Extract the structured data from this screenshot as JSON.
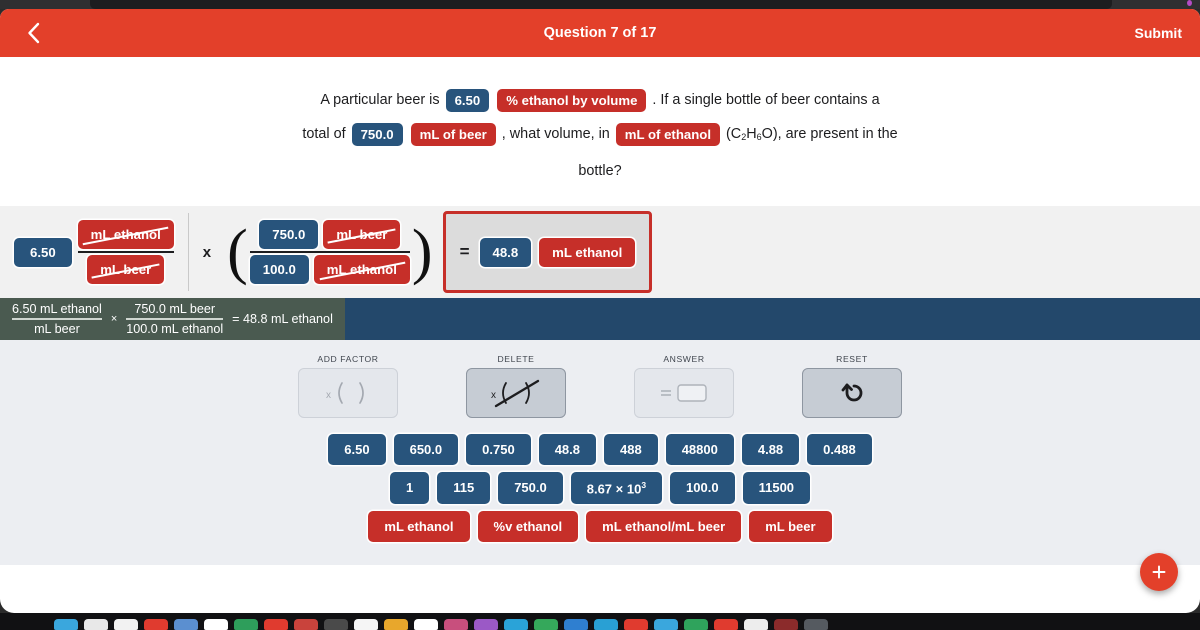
{
  "header": {
    "title": "Question 7 of 17",
    "back_icon": "chevron-left-icon",
    "submit_label": "Submit",
    "color": "#e3402a"
  },
  "question": {
    "part1": "A particular beer is",
    "value1": "6.50",
    "unit1": "% ethanol by volume",
    "part2": ". If a single bottle of beer contains a",
    "part3": "total of",
    "value2": "750.0",
    "unit2": "mL of beer",
    "part4": ", what volume, in",
    "unit3": "mL of ethanol",
    "formula_open": "(C",
    "formula_sub1": "2",
    "formula_h": "H",
    "formula_sub2": "6",
    "formula_close": "O),",
    "part5": "are present in the",
    "part6": "bottle?"
  },
  "equation": {
    "factor1": {
      "coefficient": "6.50",
      "numerator_unit": "mL ethanol",
      "denominator_unit": "mL beer"
    },
    "operator": "x",
    "factor2": {
      "paren_open": "(",
      "paren_close": ")",
      "numerator_value": "750.0",
      "numerator_unit": "mL beer",
      "denominator_value": "100.0",
      "denominator_unit": "mL ethanol"
    },
    "answer": {
      "equals": "=",
      "value": "48.8",
      "unit": "mL ethanol"
    }
  },
  "summary": {
    "num1": "6.50 mL ethanol",
    "den1": "mL beer",
    "times": "×",
    "num2": "750.0 mL beer",
    "den2": "100.0 mL ethanol",
    "result": "= 48.8 mL ethanol"
  },
  "tools": [
    {
      "label": "ADD FACTOR",
      "icon": "add-factor-icon",
      "state": "normal"
    },
    {
      "label": "DELETE",
      "icon": "delete-strike-icon",
      "state": "active"
    },
    {
      "label": "ANSWER",
      "icon": "answer-box-icon",
      "state": "disabled"
    },
    {
      "label": "RESET",
      "icon": "undo-arrow-icon",
      "state": "normal"
    }
  ],
  "palette": {
    "row1": [
      "6.50",
      "650.0",
      "0.750",
      "48.8",
      "488",
      "48800",
      "4.88",
      "0.488"
    ],
    "row2_prefix": [
      "1",
      "115",
      "750.0"
    ],
    "row2_sci": {
      "mantissa": "8.67 × 10",
      "exponent": "3"
    },
    "row2_suffix": [
      "100.0",
      "11500"
    ],
    "units": [
      "mL ethanol",
      "%v ethanol",
      "mL ethanol/mL beer",
      "mL beer"
    ]
  },
  "fab": {
    "icon": "plus-icon",
    "color": "#e3402a"
  },
  "dock": {
    "icon_colors": [
      "#3aa7dd",
      "#e8e8e8",
      "#f2f2f2",
      "#e03b2f",
      "#5b8fd0",
      "#ffffff",
      "#2e9e5b",
      "#e03b2f",
      "#c9433c",
      "#4a4a4a",
      "#f5f5f5",
      "#e8a72c",
      "#ffffff",
      "#c84f7d",
      "#9b59c6",
      "#2aa3d8",
      "#35a85b",
      "#2f7fd0",
      "#29a0d4",
      "#e03b2f",
      "#3aa7dd",
      "#2fa35c",
      "#e03b2f",
      "#ededed",
      "#8b2b2b",
      "#555a60"
    ]
  }
}
